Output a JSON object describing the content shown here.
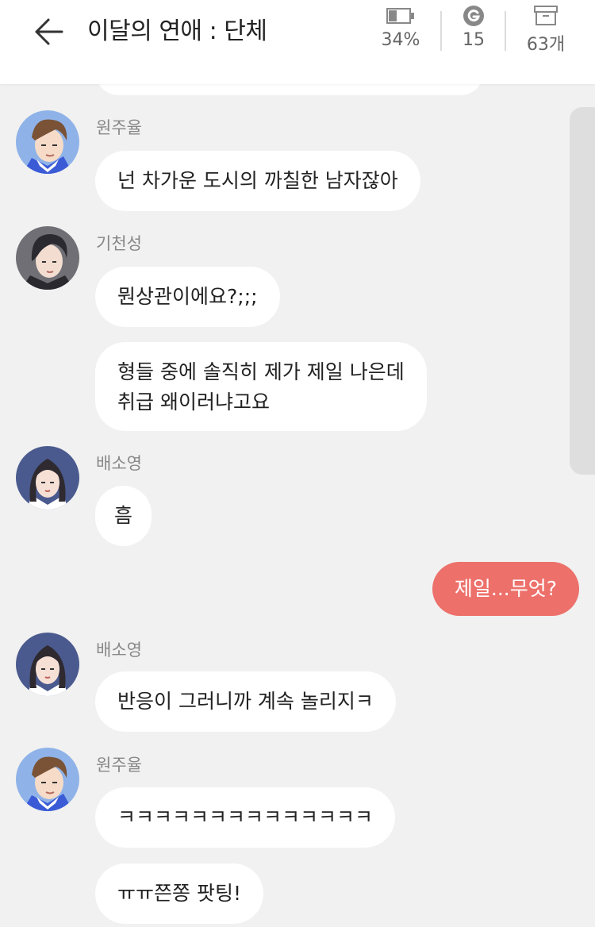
{
  "header": {
    "title": "이달의 연애 : 단체",
    "stats": {
      "battery": {
        "value": "34%",
        "icon": "battery-icon",
        "level": 0.34
      },
      "gem": {
        "value": "15",
        "icon": "g-coin-icon"
      },
      "inbox": {
        "value": "63개",
        "icon": "archive-box-icon"
      }
    }
  },
  "messages": [
    {
      "sender": "원주율",
      "lines": [
        "넌 차가운 도시의 까칠한 남자잖아"
      ]
    },
    {
      "sender": "기천성",
      "lines": [
        "뭔상관이에요?;;;"
      ]
    },
    {
      "sender": "",
      "lines": [
        "형들 중에 솔직히 제가 제일 나은데",
        "취급 왜이러냐고요"
      ]
    },
    {
      "sender": "배소영",
      "lines": [
        "흠"
      ]
    },
    {
      "sender": "me",
      "lines": [
        "제일...무엇?"
      ]
    },
    {
      "sender": "배소영",
      "lines": [
        "반응이 그러니까 계속 놀리지ㅋ"
      ]
    },
    {
      "sender": "원주율",
      "lines": [
        "ㅋㅋㅋㅋㅋㅋㅋㅋㅋㅋㅋㅋㅋㅋ"
      ]
    },
    {
      "sender": "",
      "lines": [
        "ㅠㅠ쯘쫑 팟팅!"
      ]
    }
  ],
  "colors": {
    "background": "#f1f1f1",
    "my_bubble": "#ed706b",
    "other_bubble": "#ffffff"
  }
}
